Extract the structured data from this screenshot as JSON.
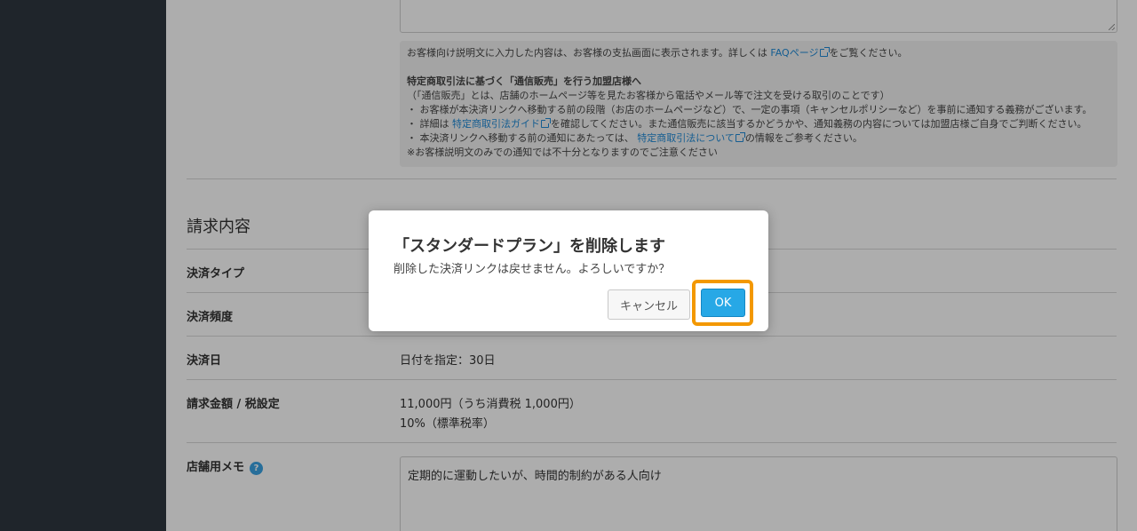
{
  "info": {
    "line1_pre": "お客様向け説明文に入力した内容は、お客様の支払画面に表示されます。詳しくは ",
    "line1_link": "FAQページ",
    "line1_post": "をご覧ください。",
    "heading": "特定商取引法に基づく「通信販売」を行う加盟店様へ",
    "line2": "（「通信販売」とは、店舗のホームページ等を見たお客様から電話やメール等で注文を受ける取引のことです）",
    "line3": "・ お客様が本決済リンクへ移動する前の段階（お店のホームページなど）で、一定の事項（キャンセルポリシーなど）を事前に通知する義務がございます。",
    "line4_pre": "・ 詳細は ",
    "line4_link": "特定商取引法ガイド",
    "line4_post": "を確認してください。また通信販売に該当するかどうかや、通知義務の内容については加盟店様ご自身でご判断ください。",
    "line5_pre": "・ 本決済リンクへ移動する前の通知にあたっては、 ",
    "line5_link": "特定商取引法について",
    "line5_post": "の情報をご参考ください。",
    "line6": "※お客様説明文のみでの通知では不十分となりますのでご注意ください"
  },
  "section": {
    "title": "請求内容",
    "rows": [
      {
        "label": "決済タイプ",
        "value": ""
      },
      {
        "label": "決済頻度",
        "value": ""
      },
      {
        "label": "決済日",
        "value": "日付を指定：30日"
      },
      {
        "label": "請求金額 / 税設定",
        "value": "11,000円（うち消費税 1,000円）",
        "value2": "10%（標準税率）"
      },
      {
        "label": "店舗用メモ",
        "value": ""
      }
    ],
    "memo_text": "定期的に運動したいが、時間的制約がある人向け",
    "help_glyph": "?"
  },
  "modal": {
    "title": "「スタンダードプラン」を削除します",
    "message": "削除した決済リンクは戻せません。よろしいですか？",
    "cancel_label": "キャンセル",
    "ok_label": "OK"
  }
}
